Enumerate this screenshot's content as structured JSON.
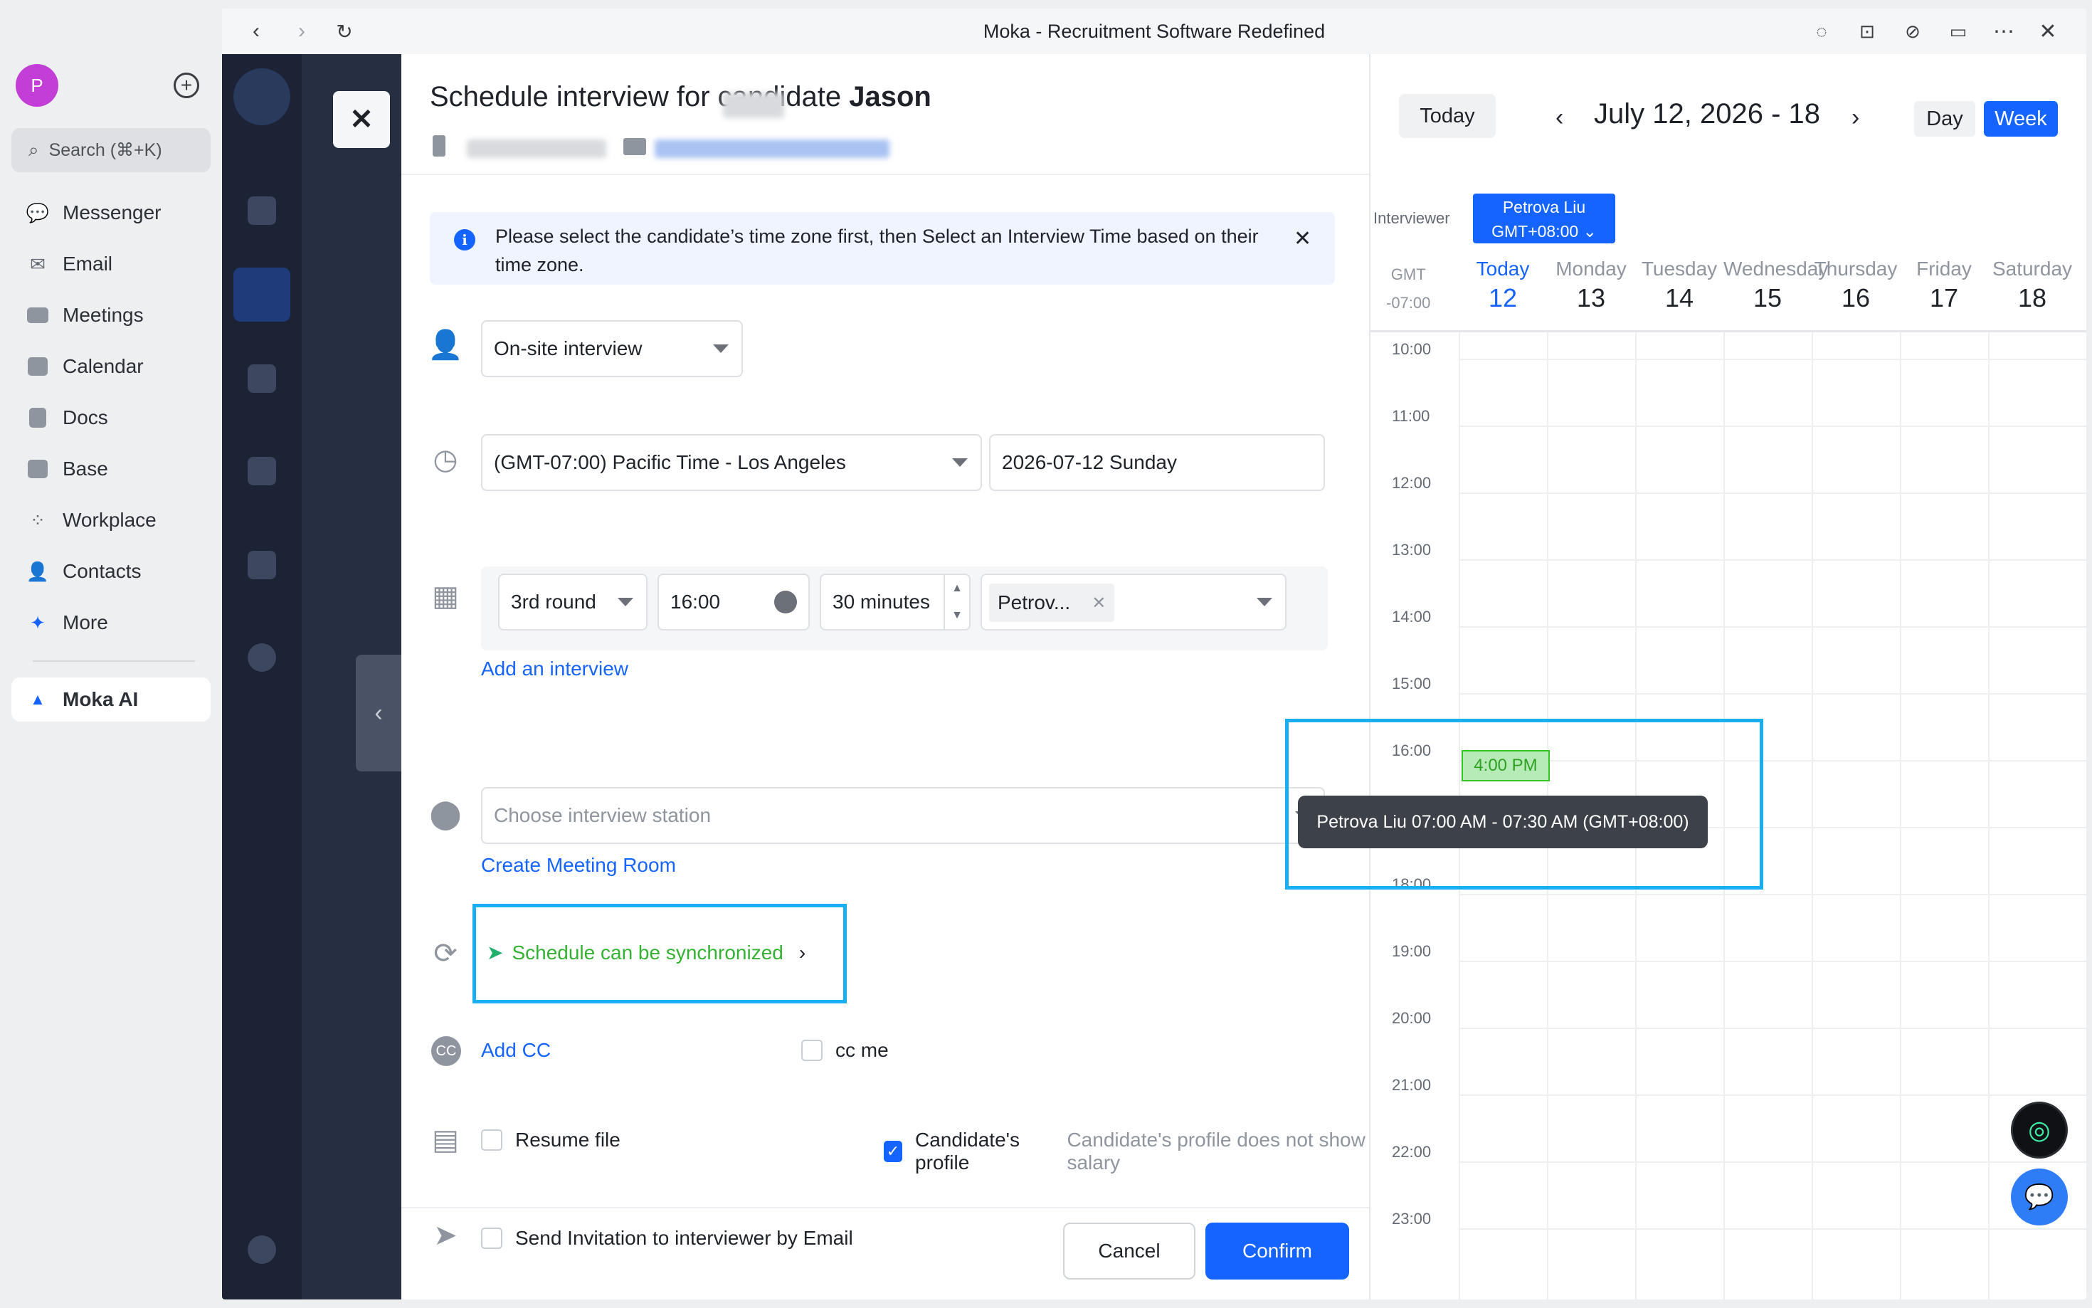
{
  "sidebar": {
    "avatar_letter": "P",
    "search_placeholder": "Search (⌘+K)",
    "items": [
      {
        "label": "Messenger",
        "icon": "messenger-icon"
      },
      {
        "label": "Email",
        "icon": "email-icon"
      },
      {
        "label": "Meetings",
        "icon": "meetings-icon"
      },
      {
        "label": "Calendar",
        "icon": "calendar-icon"
      },
      {
        "label": "Docs",
        "icon": "docs-icon"
      },
      {
        "label": "Base",
        "icon": "base-icon"
      },
      {
        "label": "Workplace",
        "icon": "workplace-icon"
      },
      {
        "label": "Contacts",
        "icon": "contacts-icon"
      },
      {
        "label": "More",
        "icon": "more-apps-icon"
      }
    ],
    "active_item": "Moka AI"
  },
  "window": {
    "title": "Moka - Recruitment Software Redefined"
  },
  "modal": {
    "title_prefix": "Schedule interview for candidate ",
    "candidate_name": "Jason",
    "notice": "Please select the candidate’s time zone first, then Select an Interview Time based on their time zone.",
    "interview_type": "On-site interview",
    "timezone": "(GMT-07:00) Pacific Time - Los Angeles",
    "date": "2026-07-12 Sunday",
    "round": "3rd round",
    "time": "16:00",
    "duration": "30 minutes",
    "interviewer_tag": "Petrov...",
    "add_interview": "Add an interview",
    "station_placeholder": "Choose interview station",
    "create_meeting_room": "Create Meeting Room",
    "sync_text": "Schedule can be synchronized",
    "add_cc": "Add CC",
    "cc_me": "cc me",
    "resume_file": "Resume file",
    "candidate_profile": "Candidate's profile",
    "profile_note": "Candidate's profile does not show salary",
    "send_invitation": "Send Invitation to interviewer by Email",
    "cancel": "Cancel",
    "confirm": "Confirm",
    "checked": {
      "resume_file": false,
      "candidate_profile": true,
      "cc_me": false,
      "send_invitation": false
    }
  },
  "calendar": {
    "today_button": "Today",
    "range": "July 12, 2026 - 18",
    "day_button": "Day",
    "week_button": "Week",
    "interviewer_label": "Interviewer",
    "person_name": "Petrova Liu",
    "person_tz": "GMT+08:00",
    "gmt_label_1": "GMT",
    "gmt_label_2": "-07:00",
    "days": [
      {
        "name": "Today",
        "num": "12"
      },
      {
        "name": "Monday",
        "num": "13"
      },
      {
        "name": "Tuesday",
        "num": "14"
      },
      {
        "name": "Wednesday",
        "num": "15"
      },
      {
        "name": "Thursday",
        "num": "16"
      },
      {
        "name": "Friday",
        "num": "17"
      },
      {
        "name": "Saturday",
        "num": "18"
      }
    ],
    "hours": [
      "10:00",
      "11:00",
      "12:00",
      "13:00",
      "14:00",
      "15:00",
      "16:00",
      "18:00",
      "19:00",
      "20:00",
      "21:00",
      "22:00",
      "23:00"
    ],
    "event_label": "4:00 PM",
    "tooltip": "Petrova Liu 07:00 AM - 07:30 AM (GMT+08:00)"
  },
  "colors": {
    "accent": "#1664ff",
    "highlight": "#19aef0",
    "success": "#34c724"
  }
}
